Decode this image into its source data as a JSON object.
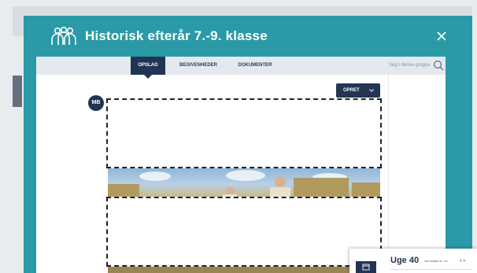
{
  "modal": {
    "title": "Historisk efterår 7.-9. klasse",
    "header_color": "#2a9aa6"
  },
  "tabs": [
    {
      "label": "OPSLAG",
      "active": true
    },
    {
      "label": "BEGIVENHEDER",
      "active": false
    },
    {
      "label": "DOKUMENTER",
      "active": false
    }
  ],
  "search": {
    "placeholder": "Søg i denne gruppe"
  },
  "post": {
    "avatar_initials": "MB",
    "create_button_label": "OPRET"
  },
  "calendar": {
    "week_title": "Uge 40",
    "date_range": "SEPTEMBER 30 - OK",
    "nav": "< >"
  },
  "colors": {
    "navy": "#233452",
    "teal": "#2a9aa6",
    "tabbar": "#e3e9ee"
  },
  "icons": [
    "users-group-icon",
    "close-icon",
    "search-icon",
    "chevron-down-icon",
    "calendar-icon"
  ]
}
